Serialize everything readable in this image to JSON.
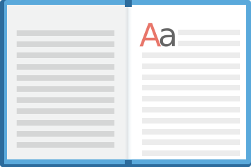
{
  "book": {
    "sample_upper": "A",
    "sample_lower": "a",
    "left_page_lines": 11,
    "right_page_short_lines": 2,
    "right_page_full_lines": 10
  },
  "colors": {
    "cover": "#5aa9db",
    "cover_dark": "#2c6b9c",
    "page_left": "#f1f2f2",
    "page_right": "#ffffff",
    "line_left": "#d5d6d6",
    "line_right": "#ececec",
    "glyph_upper": "#e8766a",
    "glyph_lower": "#666666"
  }
}
